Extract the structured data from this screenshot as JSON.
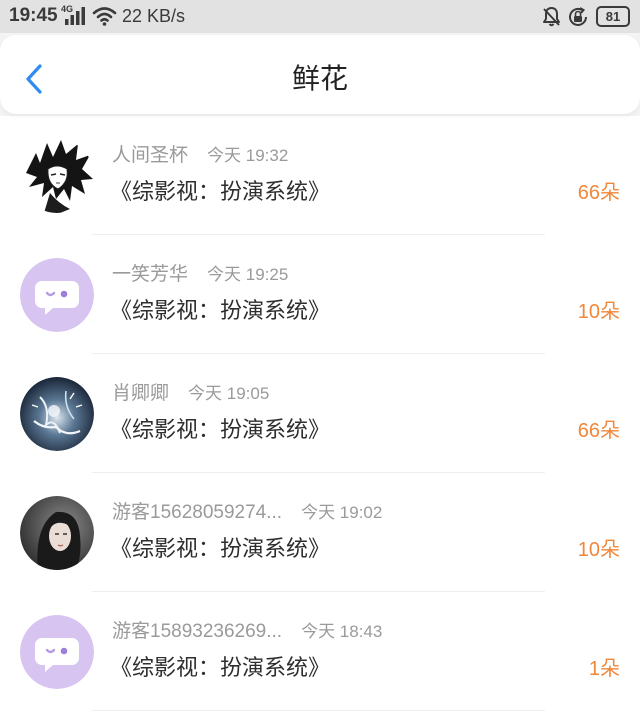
{
  "status_bar": {
    "time": "19:45",
    "network_type": "4G",
    "speed": "22 KB/s",
    "battery": "81",
    "icons": [
      "signal-icon",
      "wifi-icon",
      "notifications-off-icon",
      "rotation-lock-icon",
      "battery-icon"
    ]
  },
  "header": {
    "title": "鲜花",
    "back_icon": "chevron-left-icon"
  },
  "colors": {
    "accent": "#2d8cf0",
    "count": "#f0873a",
    "secondary_text": "#9a9a9a",
    "primary_text": "#2e2e2e",
    "default_avatar": "#d7c4f1",
    "status_bar_bg": "#e2e2e2"
  },
  "items": [
    {
      "user": "人间圣杯",
      "time": "今天 19:32",
      "book": "《综影视：扮演系统》",
      "count": "66朵",
      "avatar": "anime-character-avatar"
    },
    {
      "user": "一笑芳华",
      "time": "今天 19:25",
      "book": "《综影视：扮演系统》",
      "count": "10朵",
      "avatar": "default-chat-avatar"
    },
    {
      "user": "肖卿卿",
      "time": "今天 19:05",
      "book": "《综影视：扮演系统》",
      "count": "66朵",
      "avatar": "illustration-avatar"
    },
    {
      "user": "游客15628059274...",
      "time": "今天 19:02",
      "book": "《综影视：扮演系统》",
      "count": "10朵",
      "avatar": "photo-avatar"
    },
    {
      "user": "游客15893236269...",
      "time": "今天 18:43",
      "book": "《综影视：扮演系统》",
      "count": "1朵",
      "avatar": "default-chat-avatar"
    }
  ]
}
